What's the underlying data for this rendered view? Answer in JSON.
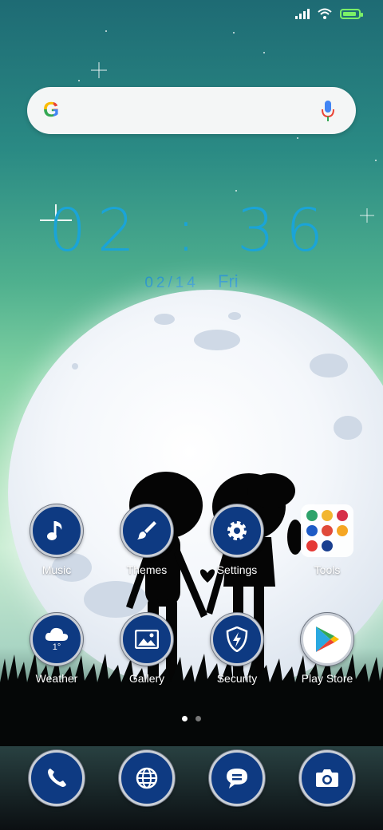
{
  "status_bar": {
    "icons": [
      "signal-icon",
      "wifi-icon",
      "battery-charging-icon"
    ],
    "battery_color": "#7bf067"
  },
  "search": {
    "logo": "G",
    "icons": [
      "google-logo-icon",
      "microphone-icon"
    ]
  },
  "clock": {
    "time": "02 : 36",
    "date": "02/14",
    "weekday": "Fri",
    "color": "#1aa4d8"
  },
  "apps_row1": [
    {
      "label": "Music",
      "icon": "music-note-icon"
    },
    {
      "label": "Themes",
      "icon": "paintbrush-icon"
    },
    {
      "label": "Settings",
      "icon": "gear-icon"
    },
    {
      "label": "Tools",
      "icon": "folder-icon"
    }
  ],
  "apps_row2": [
    {
      "label": "Weather",
      "icon": "cloud-snow-icon",
      "temp": "1°"
    },
    {
      "label": "Gallery",
      "icon": "image-icon"
    },
    {
      "label": "Security",
      "icon": "shield-lightning-icon"
    },
    {
      "label": "Play Store",
      "icon": "play-store-icon"
    }
  ],
  "page_indicator": {
    "pages": 2,
    "current": 1
  },
  "dock": [
    {
      "name": "Phone",
      "icon": "phone-icon"
    },
    {
      "name": "Browser",
      "icon": "globe-icon"
    },
    {
      "name": "Messages",
      "icon": "chat-bubble-icon"
    },
    {
      "name": "Camera",
      "icon": "camera-icon"
    }
  ],
  "colors": {
    "icon_bg": "#0e3a82",
    "icon_ring": "#c9ced6"
  }
}
